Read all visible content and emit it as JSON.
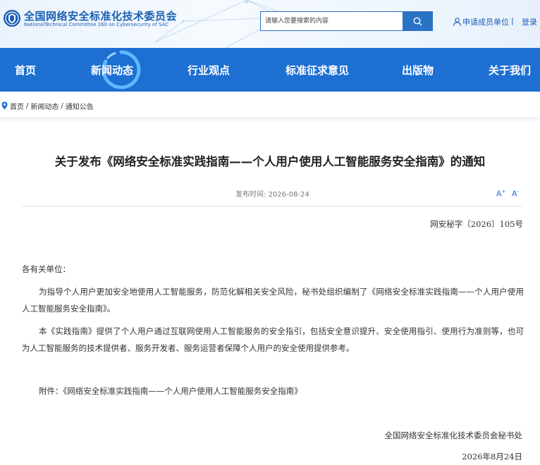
{
  "header": {
    "org_name_cn": "全国网络安全标准化技术委员会",
    "org_name_en": "NationalTechnical Committee 260 on Cybersecurity of SAC",
    "search_placeholder": "请输入您要搜索的内容",
    "member_link": "申请成员单位",
    "divider": "|",
    "login": "登录"
  },
  "nav": {
    "items": [
      "首页",
      "新闻动态",
      "行业观点",
      "标准征求意见",
      "出版物",
      "关于我们"
    ],
    "active": "新闻动态"
  },
  "breadcrumb": [
    "首页",
    "新闻动态",
    "通知公告"
  ],
  "breadcrumb_sep": "/",
  "article": {
    "title": "关于发布《网络安全标准实践指南——个人用户使用人工智能服务安全指南》的通知",
    "pub_label": "发布时间:",
    "pub_date": "2026-08-24",
    "font_increase": "A",
    "font_decrease": "A",
    "doc_number": "网安秘字〔2026〕105号",
    "salutation": "各有关单位：",
    "paragraph1": "为指导个人用户更加安全地使用人工智能服务，防范化解相关安全风险，秘书处组织编制了《网络安全标准实践指南——个人用户使用人工智能服务安全指南》。",
    "paragraph2": "本《实践指南》提供了个人用户通过互联网使用人工智能服务的安全指引，包括安全意识提升、安全使用指引、使用行为准则等，也可为人工智能服务的技术提供者、服务开发者、服务运营者保障个人用户的安全使用提供参考。",
    "attachment": "附件：《网络安全标准实践指南——个人用户使用人工智能服务安全指南》",
    "signer": "全国网络安全标准化技术委员会秘书处",
    "sign_date": "2026年8月24日"
  },
  "colors": {
    "brand_blue": "#1d6fd2",
    "nav_bg": "#1d6fd2",
    "header_bg": "#eaf3fc"
  }
}
